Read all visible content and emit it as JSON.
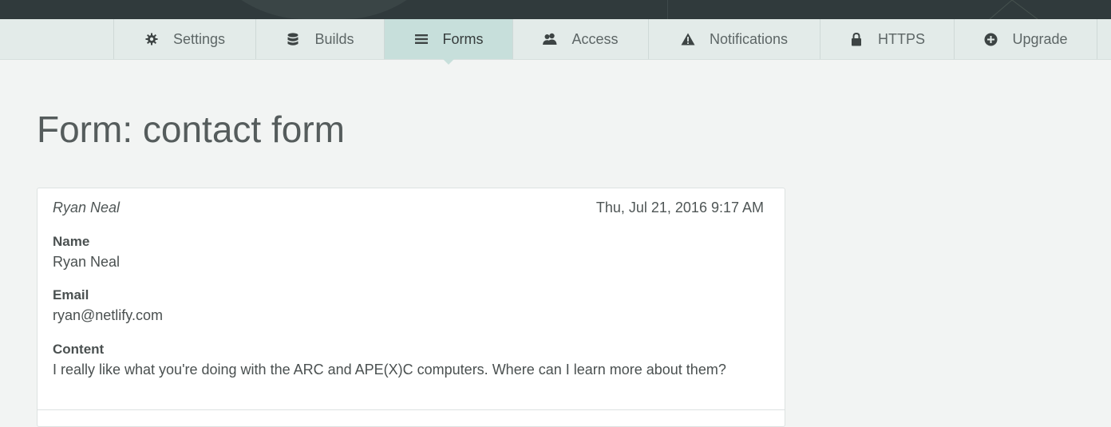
{
  "nav": {
    "tabs": [
      {
        "label": "Settings",
        "icon": "gear-icon"
      },
      {
        "label": "Builds",
        "icon": "database-icon"
      },
      {
        "label": "Forms",
        "icon": "list-icon",
        "active": true
      },
      {
        "label": "Access",
        "icon": "users-icon"
      },
      {
        "label": "Notifications",
        "icon": "warning-icon"
      },
      {
        "label": "HTTPS",
        "icon": "lock-icon"
      },
      {
        "label": "Upgrade",
        "icon": "plus-circle-icon"
      }
    ]
  },
  "page": {
    "title": "Form: contact form"
  },
  "submission": {
    "sender": "Ryan Neal",
    "date": "Thu, Jul 21, 2016 9:17 AM",
    "fields": [
      {
        "label": "Name",
        "value": "Ryan Neal"
      },
      {
        "label": "Email",
        "value": "ryan@netlify.com"
      },
      {
        "label": "Content",
        "value": "I really like what you're doing with the ARC and APE(X)C computers. Where can I learn more about them?"
      }
    ]
  },
  "colors": {
    "nav_bg": "#e3ebe9",
    "active_tab": "#c7dfdb",
    "topbar": "#303a3c",
    "page_bg": "#f2f4f3"
  }
}
